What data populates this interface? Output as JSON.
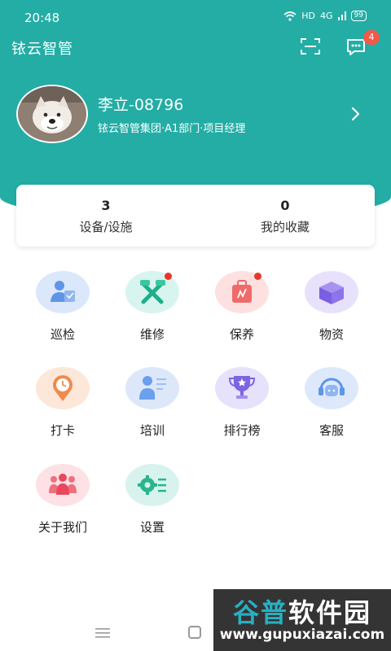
{
  "status_bar": {
    "time": "20:48",
    "network": "HD",
    "signal": "4G",
    "battery": "99"
  },
  "header": {
    "app_title": "铱云智管",
    "message_badge": "4"
  },
  "profile": {
    "name": "李立-08796",
    "org": "铱云智管集团·A1部门·项目经理"
  },
  "stats": [
    {
      "value": "3",
      "label": "设备/设施"
    },
    {
      "value": "0",
      "label": "我的收藏"
    }
  ],
  "menu": [
    {
      "label": "巡检",
      "icon": "inspection-icon",
      "color": "#dbe8fb"
    },
    {
      "label": "维修",
      "icon": "repair-tools-icon",
      "color": "#d8f4ee"
    },
    {
      "label": "保养",
      "icon": "maintenance-bag-icon",
      "color": "#fde1e1"
    },
    {
      "label": "物资",
      "icon": "supplies-box-icon",
      "color": "#e7e1fb"
    },
    {
      "label": "打卡",
      "icon": "clock-in-icon",
      "color": "#fde7d9"
    },
    {
      "label": "培训",
      "icon": "training-icon",
      "color": "#dce8fa"
    },
    {
      "label": "排行榜",
      "icon": "trophy-icon",
      "color": "#e6e2fb"
    },
    {
      "label": "客服",
      "icon": "headset-icon",
      "color": "#dde9fb"
    },
    {
      "label": "关于我们",
      "icon": "team-icon",
      "color": "#fde1e4"
    },
    {
      "label": "设置",
      "icon": "settings-icon",
      "color": "#d8f3ee"
    }
  ],
  "watermark": {
    "brand_a": "谷普",
    "brand_b": "软件园",
    "url": "www.gupuxiazai.com"
  }
}
